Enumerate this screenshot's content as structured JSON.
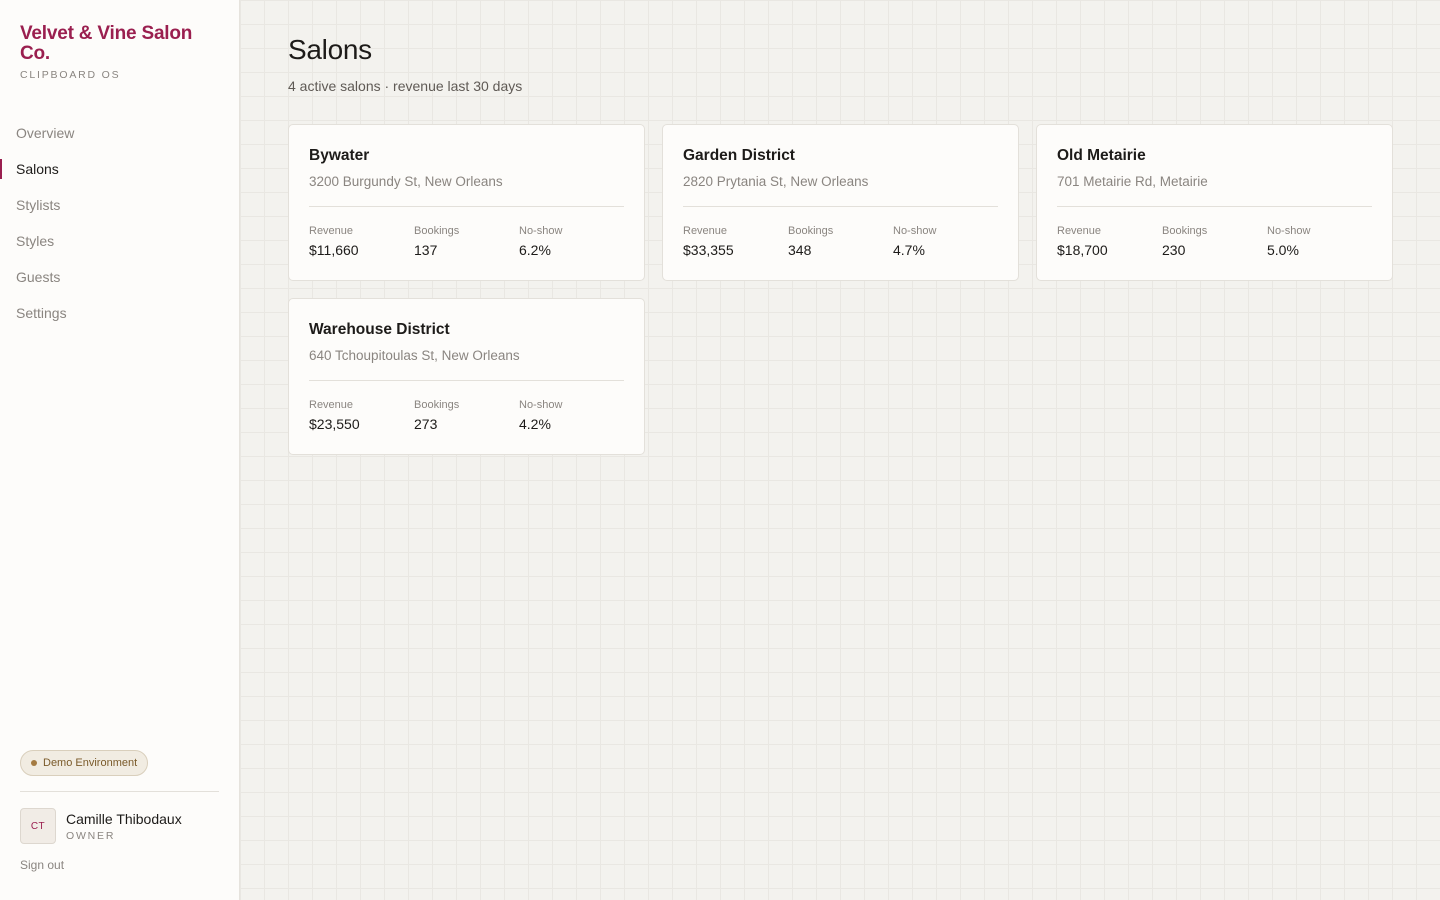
{
  "brand": {
    "name": "Velvet & Vine Salon Co.",
    "subtitle": "CLIPBOARD OS"
  },
  "nav": {
    "items": [
      {
        "label": "Overview",
        "active": false
      },
      {
        "label": "Salons",
        "active": true
      },
      {
        "label": "Stylists",
        "active": false
      },
      {
        "label": "Styles",
        "active": false
      },
      {
        "label": "Guests",
        "active": false
      },
      {
        "label": "Settings",
        "active": false
      }
    ]
  },
  "env_badge": "Demo Environment",
  "user": {
    "initials": "CT",
    "name": "Camille Thibodaux",
    "role": "OWNER",
    "signout": "Sign out"
  },
  "page": {
    "title": "Salons",
    "subtitle": "4 active salons · revenue last 30 days"
  },
  "stat_labels": {
    "revenue": "Revenue",
    "bookings": "Bookings",
    "noshow": "No-show"
  },
  "salons": [
    {
      "name": "Bywater",
      "address": "3200 Burgundy St, New Orleans",
      "revenue": "$11,660",
      "bookings": "137",
      "noshow": "6.2%"
    },
    {
      "name": "Garden District",
      "address": "2820 Prytania St, New Orleans",
      "revenue": "$33,355",
      "bookings": "348",
      "noshow": "4.7%"
    },
    {
      "name": "Old Metairie",
      "address": "701 Metairie Rd, Metairie",
      "revenue": "$18,700",
      "bookings": "230",
      "noshow": "5.0%"
    },
    {
      "name": "Warehouse District",
      "address": "640 Tchoupitoulas St, New Orleans",
      "revenue": "$23,550",
      "bookings": "273",
      "noshow": "4.2%"
    }
  ],
  "colors": {
    "accent": "#9a1f4f",
    "badge_text": "#7a5a2a",
    "background": "#f3f2ee"
  }
}
